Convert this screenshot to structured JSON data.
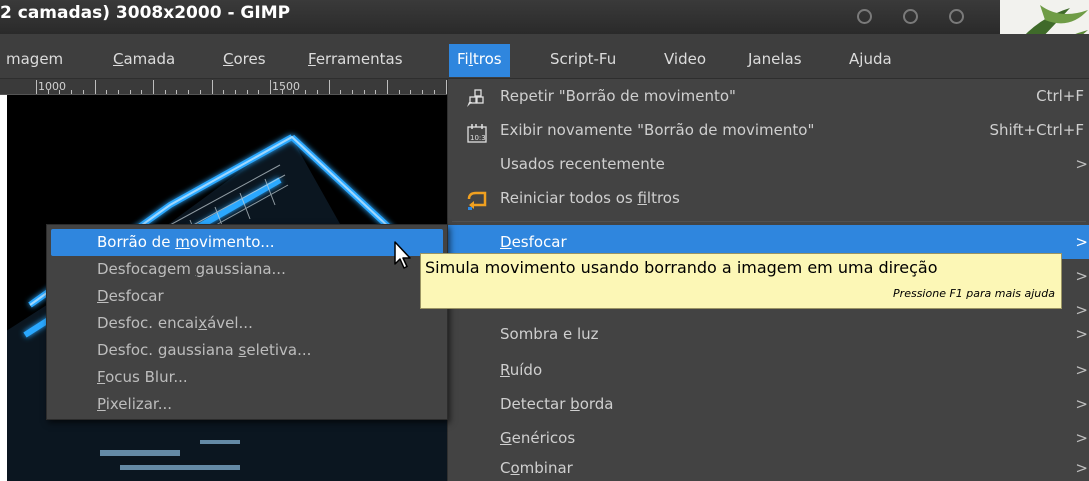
{
  "window": {
    "title": "2 camadas) 3008x2000 - GIMP"
  },
  "menubar": {
    "items": [
      "magem",
      "Camada",
      "Cores",
      "Ferramentas",
      "Filtros",
      "Script-Fu",
      "Video",
      "Janelas",
      "Ajuda"
    ],
    "active": "Filtros"
  },
  "ruler": {
    "labels": [
      "1000",
      "1500"
    ]
  },
  "filters_menu": {
    "repeat": {
      "label": "Repetir \"Borrão de movimento\"",
      "accel": "Ctrl+F"
    },
    "reshow": {
      "label": "Exibir novamente \"Borrão de movimento\"",
      "accel": "Shift+Ctrl+F"
    },
    "recent": {
      "label": "Usados recentemente"
    },
    "reset": {
      "label": "Reiniciar todos os filtros"
    },
    "blur": {
      "label": "Desfocar"
    },
    "light_shadow": {
      "label": "Sombra e luz"
    },
    "noise": {
      "label": "Ruído"
    },
    "edge_detect": {
      "label": "Detectar borda"
    },
    "generic": {
      "label": "Genéricos"
    },
    "combine": {
      "label": "Combinar"
    }
  },
  "blur_submenu": {
    "items": [
      "Borrão de movimento...",
      "Desfocagem gaussiana...",
      "Desfocar",
      "Desfoc. encaixável...",
      "Desfoc. gaussiana seletiva...",
      "Focus Blur...",
      "Pixelizar..."
    ],
    "selected": "Borrão de movimento..."
  },
  "tooltip": {
    "text": "Simula movimento usando borrando a imagem em uma direção",
    "hint": "Pressione F1 para mais ajuda"
  },
  "colors": {
    "accent": "#2f86de",
    "menu_bg": "#434343",
    "tooltip_bg": "#fcf7b6",
    "neon": "#2aa8ff"
  }
}
